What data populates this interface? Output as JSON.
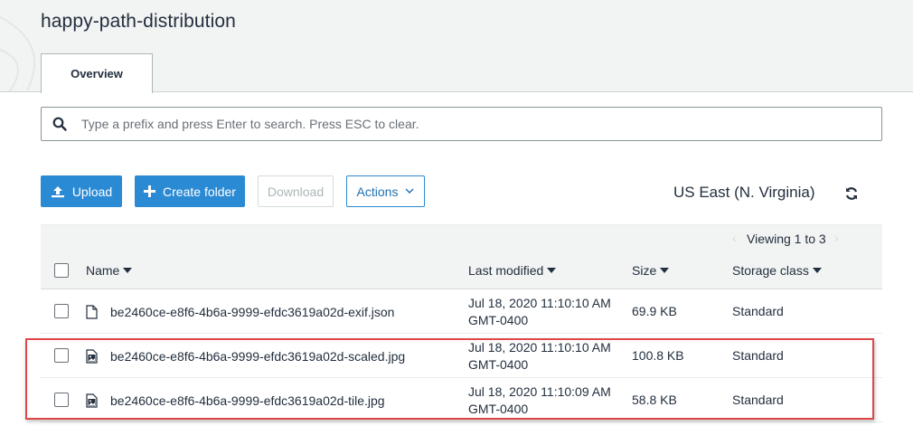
{
  "header": {
    "bucket_name": "happy-path-distribution",
    "tabs": [
      {
        "label": "Overview"
      }
    ]
  },
  "search": {
    "placeholder": "Type a prefix and press Enter to search. Press ESC to clear.",
    "icon": "search-icon"
  },
  "toolbar": {
    "upload_label": "Upload",
    "create_folder_label": "Create folder",
    "download_label": "Download",
    "actions_label": "Actions",
    "region": "US East (N. Virginia)",
    "refresh_icon": "refresh-icon"
  },
  "table": {
    "viewing": "Viewing 1 to 3",
    "columns": [
      "Name",
      "Last modified",
      "Size",
      "Storage class"
    ],
    "rows": [
      {
        "name": "be2460ce-e8f6-4b6a-9999-efdc3619a02d-exif.json",
        "icon": "file-icon",
        "modified_date": "Jul 18, 2020 11:10:10 AM",
        "modified_tz": "GMT-0400",
        "size": "69.9 KB",
        "storage_class": "Standard"
      },
      {
        "name": "be2460ce-e8f6-4b6a-9999-efdc3619a02d-scaled.jpg",
        "icon": "image-icon",
        "modified_date": "Jul 18, 2020 11:10:10 AM",
        "modified_tz": "GMT-0400",
        "size": "100.8 KB",
        "storage_class": "Standard"
      },
      {
        "name": "be2460ce-e8f6-4b6a-9999-efdc3619a02d-tile.jpg",
        "icon": "image-icon",
        "modified_date": "Jul 18, 2020 11:10:09 AM",
        "modified_tz": "GMT-0400",
        "size": "58.8 KB",
        "storage_class": "Standard"
      }
    ]
  },
  "colors": {
    "primary": "#2b8ad4",
    "highlight": "#e0464a",
    "header_bg": "#f2f3f3"
  }
}
